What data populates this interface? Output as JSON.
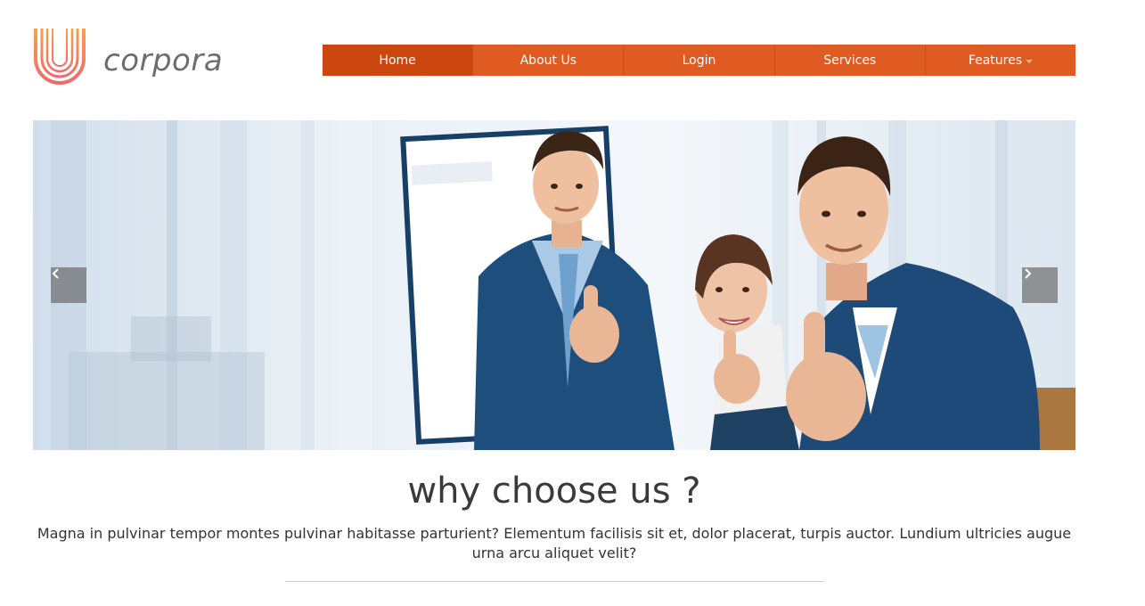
{
  "logo": {
    "text": "corpora"
  },
  "nav": {
    "items": [
      {
        "label": "Home"
      },
      {
        "label": "About Us"
      },
      {
        "label": "Login"
      },
      {
        "label": "Services"
      },
      {
        "label": "Features"
      }
    ],
    "active_index": 0
  },
  "carousel": {
    "prev_icon": "chevron-left-icon",
    "next_icon": "chevron-right-icon"
  },
  "section": {
    "heading": "why choose us ?",
    "intro": "Magna in pulvinar tempor montes pulvinar habitasse parturient? Elementum facilisis sit et, dolor placerat, turpis auctor. Lundium ultricies augue urna arcu aliquet velit?"
  },
  "colors": {
    "brand_orange": "#e05b22",
    "nav_active": "#cc470f"
  }
}
